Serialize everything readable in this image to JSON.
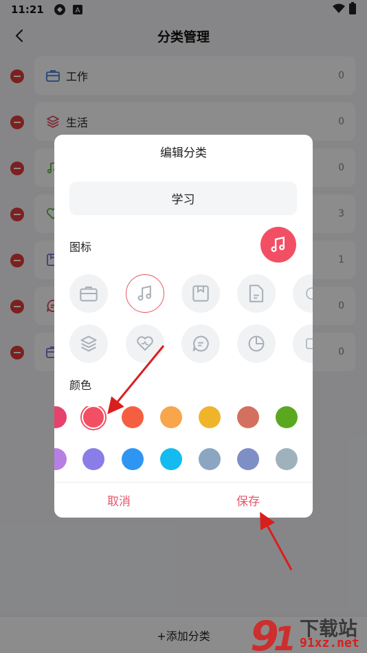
{
  "status_bar": {
    "time": "11:21"
  },
  "header": {
    "title": "分类管理"
  },
  "categories": [
    {
      "name": "工作",
      "count": "0",
      "icon": "briefcase-icon",
      "color": "#3d7fe0"
    },
    {
      "name": "生活",
      "count": "0",
      "icon": "layers-icon",
      "color": "#e0465a"
    },
    {
      "name": "",
      "count": "0",
      "icon": "music-icon",
      "color": "#5bb33a"
    },
    {
      "name": "",
      "count": "3",
      "icon": "heart-icon",
      "color": "#5bb33a"
    },
    {
      "name": "",
      "count": "1",
      "icon": "bookmark-icon",
      "color": "#8a63d2"
    },
    {
      "name": "",
      "count": "0",
      "icon": "chat-icon",
      "color": "#e0465a"
    },
    {
      "name": "",
      "count": "0",
      "icon": "briefcase-icon",
      "color": "#8a63d2"
    }
  ],
  "bottom": {
    "add_label": "+添加分类"
  },
  "dialog": {
    "title": "编辑分类",
    "name_value": "学习",
    "icon_label": "图标",
    "color_label": "颜色",
    "cancel_label": "取消",
    "save_label": "保存",
    "preview_color": "#f34f64",
    "icons": [
      "briefcase-icon",
      "music-icon",
      "bookmark-icon",
      "document-icon",
      "partial-icon",
      "layers-icon",
      "heart-icon",
      "chat-icon",
      "pie-chart-icon",
      "partial-icon"
    ],
    "selected_icon": "music-icon",
    "colors_row1": [
      "#e5426d",
      "#f34f64",
      "#f4603f",
      "#f8a54c",
      "#f0b42b",
      "#d3705f",
      "#5aa820"
    ],
    "colors_row2": [
      "#b77fe3",
      "#8a7de8",
      "#2f95f2",
      "#15bbee",
      "#8aa6c1",
      "#7d8fc4",
      "#9fb1bd"
    ],
    "selected_color": "#f34f64"
  },
  "watermark": {
    "brand": "下载站",
    "domain": "91xz.net"
  }
}
